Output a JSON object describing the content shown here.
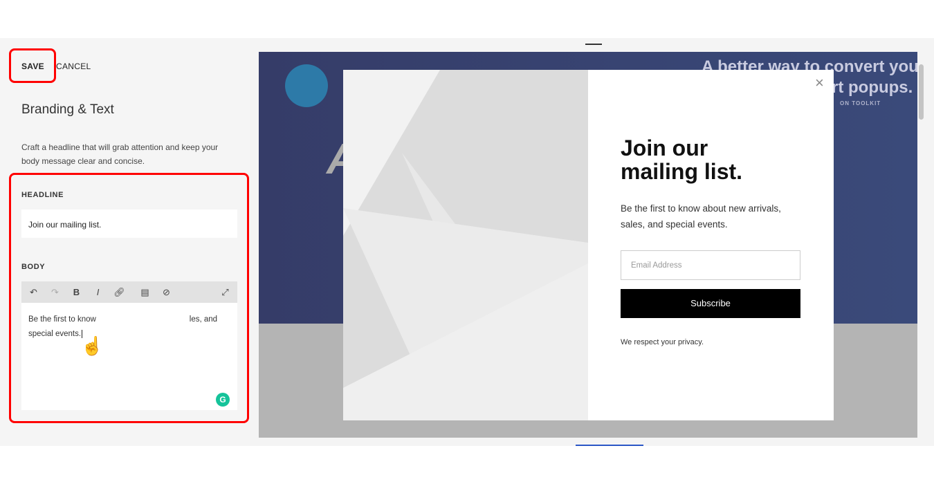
{
  "toolbar": {
    "save_label": "SAVE",
    "cancel_label": "CANCEL"
  },
  "panel": {
    "title": "Branding & Text",
    "description_line1": "Craft a headline that will grab attention and keep your",
    "description_line2": "body message clear and concise.",
    "headline_label": "HEADLINE",
    "headline_value": "Join our mailing list.",
    "body_label": "BODY",
    "body_line1_a": "Be the first to know",
    "body_line1_b": "les, and",
    "body_line2": "special events.",
    "editor_icons": [
      "undo-icon",
      "redo-icon",
      "bold-icon",
      "italic-icon",
      "link-icon",
      "clipboard-icon",
      "clear-format-icon",
      "expand-icon"
    ]
  },
  "preview": {
    "bg_headline1": "A better way to convert you",
    "bg_headline2": "rt popups.",
    "bg_sub": "ON TOOLKIT",
    "bg_letter": "A",
    "popup": {
      "title_line1": "Join our",
      "title_line2": "mailing list.",
      "body_line1": "Be the first to know about new arrivals,",
      "body_line2": "sales, and special events.",
      "email_placeholder": "Email Address",
      "subscribe_label": "Subscribe",
      "privacy": "We respect your privacy.",
      "close": "×"
    }
  },
  "colors": {
    "highlight": "#ff0000",
    "navy": "#373f6e",
    "grammarly": "#15c39a"
  }
}
